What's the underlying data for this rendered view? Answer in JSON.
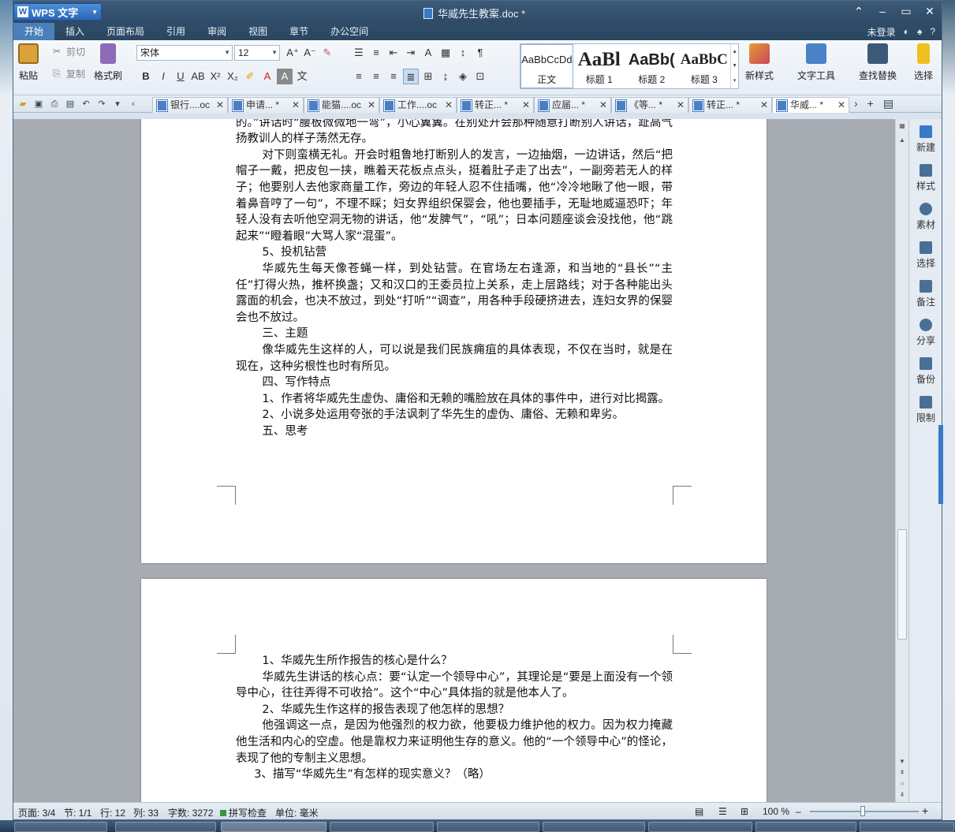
{
  "app": {
    "name": "WPS 文字",
    "doc_title": "华威先生教案.doc *"
  },
  "menu": {
    "items": [
      "开始",
      "插入",
      "页面布局",
      "引用",
      "审阅",
      "视图",
      "章节",
      "办公空间"
    ],
    "login": "未登录"
  },
  "ribbon": {
    "paste": "粘贴",
    "cut": "剪切",
    "copy": "复制",
    "format_painter": "格式刷",
    "font_name": "宋体",
    "font_size": "12",
    "styles": [
      {
        "sample": "AaBbCcDd",
        "name": "正文"
      },
      {
        "sample": "AaBl",
        "name": "标题 1"
      },
      {
        "sample": "AaBb(",
        "name": "标题 2"
      },
      {
        "sample": "AaBbC",
        "name": "标题 3"
      }
    ],
    "new_style": "新样式",
    "text_tools": "文字工具",
    "find_replace": "查找替换",
    "select": "选择"
  },
  "tabs": [
    {
      "label": "银行....oc",
      "active": false
    },
    {
      "label": "申请... *",
      "active": false
    },
    {
      "label": "能猫....oc",
      "active": false
    },
    {
      "label": "工作....oc",
      "active": false
    },
    {
      "label": "转正... *",
      "active": false
    },
    {
      "label": "应届... *",
      "active": false
    },
    {
      "label": "《等... *",
      "active": false
    },
    {
      "label": "转正... *",
      "active": false
    },
    {
      "label": "华威... *",
      "active": true
    }
  ],
  "page1": {
    "paragraphs": [
      {
        "text": "迟到了三刻钟。”“主席对他微笑一下，他还笑着伸了伸舌头，好像闯了祸怕挨骂似的。”讲话时“腰板微微地一弯”，小心翼翼。在别处开会那种随意打断别人讲话，趾高气扬教训人的样子荡然无存。",
        "indent": false
      },
      {
        "text": "对下则蛮横无礼。开会时粗鲁地打断别人的发言，一边抽烟，一边讲话，然后“把帽子一戴，把皮包一挟，瞧着天花板点点头，挺着肚子走了出去”，一副旁若无人的样子；他要别人去他家商量工作，旁边的年轻人忍不住插嘴，他“冷冷地瞅了他一眼，带着鼻音哼了一句”，不理不睬；妇女界组织保婴会，他也要插手，无耻地威逼恐吓；年轻人没有去听他空洞无物的讲话，他“发脾气”，“吼”；日本问题座谈会没找他，他“跳起来”“瞪着眼”大骂人家“混蛋”。",
        "indent": true
      },
      {
        "text": "5、投机钻营",
        "indent": true
      },
      {
        "text": "华威先生每天像苍蝇一样，到处钻营。在官场左右逢源，和当地的“县长”“主任”打得火热，推杯换盏；又和汉口的王委员拉上关系，走上层路线；对于各种能出头露面的机会，也决不放过，到处“打听”“调查”，用各种手段硬挤进去，连妇女界的保婴会也不放过。",
        "indent": true
      },
      {
        "text": "三、主题",
        "indent": true
      },
      {
        "text": "像华威先生这样的人，可以说是我们民族痈疽的具体表现，不仅在当时，就是在现在，这种劣根性也时有所见。",
        "indent": true
      },
      {
        "text": "四、写作特点",
        "indent": true
      },
      {
        "text": "1、作者将华威先生虚伪、庸俗和无赖的嘴脸放在具体的事件中，进行对比揭露。",
        "indent": true
      },
      {
        "text": "2、小说多处运用夸张的手法讽刺了华先生的虚伪、庸俗、无赖和卑劣。",
        "indent": true
      },
      {
        "text": "五、思考",
        "indent": true
      }
    ]
  },
  "page2": {
    "paragraphs": [
      {
        "text": "1、华威先生所作报告的核心是什么？",
        "indent": true
      },
      {
        "text": "华威先生讲话的核心点：要“认定一个领导中心”，其理论是“要是上面没有一个领导中心，往往弄得不可收拾”。这个“中心”具体指的就是他本人了。",
        "indent": true
      },
      {
        "text": "2、华威先生作这样的报告表现了他怎样的思想？",
        "indent": true
      },
      {
        "text": "他强调这一点，是因为他强烈的权力欲，他要极力维护他的权力。因为权力掩藏他生活和内心的空虚。他是靠权力来证明他生存的意义。他的“一个领导中心”的怪论，表现了他的专制主义思想。",
        "indent": true
      },
      {
        "text": "3、描写“华威先生”有怎样的现实意义？（略）",
        "indent": "small"
      }
    ]
  },
  "sidepanel": [
    "新建",
    "样式",
    "素材",
    "选择",
    "备注",
    "分享",
    "备份",
    "限制"
  ],
  "status": {
    "page": "页面: 3/4",
    "section": "节: 1/1",
    "row": "行: 12",
    "col": "列: 33",
    "word_count": "字数: 3272",
    "spell_check": "拼写检查",
    "unit": "单位: 毫米",
    "zoom": "100 %"
  },
  "colors": {
    "accent": "#2a66b8",
    "titlebar": "#2e4a66",
    "menu_active": "#4b7fb9"
  }
}
